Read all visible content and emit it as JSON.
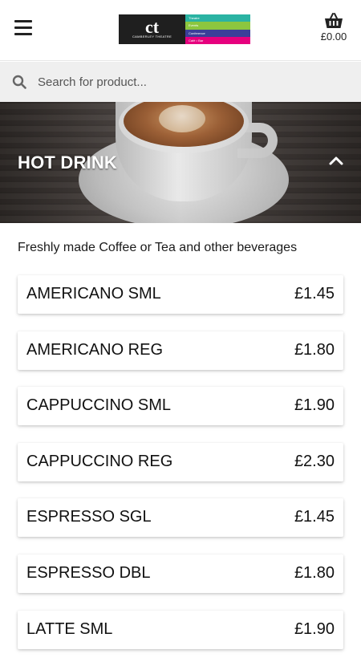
{
  "header": {
    "logo": {
      "mark": "ct",
      "subtitle": "CAMBERLEY THEATRE",
      "stripes": [
        {
          "label": "Theatre",
          "color": "#2bb3a3"
        },
        {
          "label": "Events",
          "color": "#8cc63f"
        },
        {
          "label": "Conference",
          "color": "#3b3f99"
        },
        {
          "label": "Café • Bar",
          "color": "#e6007e"
        }
      ]
    },
    "basket_total": "£0.00"
  },
  "search": {
    "placeholder": "Search for product..."
  },
  "category": {
    "title": "HOT DRINK",
    "description": "Freshly made Coffee or Tea and other beverages"
  },
  "products": [
    {
      "name": "AMERICANO SML",
      "price": "£1.45"
    },
    {
      "name": "AMERICANO REG",
      "price": "£1.80"
    },
    {
      "name": "CAPPUCCINO SML",
      "price": "£1.90"
    },
    {
      "name": "CAPPUCCINO REG",
      "price": "£2.30"
    },
    {
      "name": "ESPRESSO SGL",
      "price": "£1.45"
    },
    {
      "name": "ESPRESSO DBL",
      "price": "£1.80"
    },
    {
      "name": "LATTE SML",
      "price": "£1.90"
    }
  ]
}
